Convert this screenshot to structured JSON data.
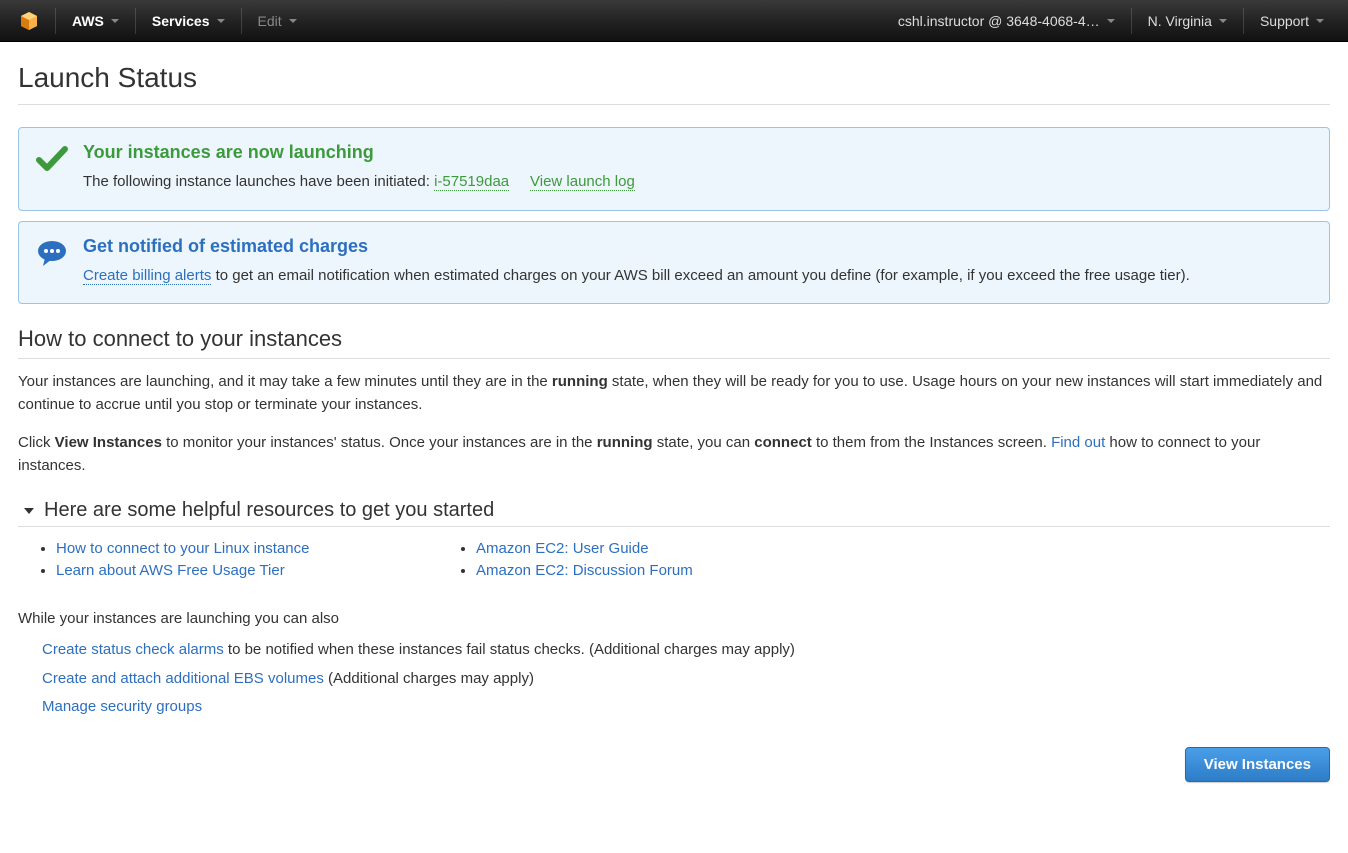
{
  "nav": {
    "aws": "AWS",
    "services": "Services",
    "edit": "Edit",
    "account": "cshl.instructor @ 3648-4068-4…",
    "region": "N. Virginia",
    "support": "Support"
  },
  "page": {
    "title": "Launch Status"
  },
  "alert_success": {
    "title": "Your instances are now launching",
    "text_before": "The following instance launches have been initiated: ",
    "instance_id": "i-57519daa",
    "view_log": "View launch log"
  },
  "alert_info": {
    "title": "Get notified of estimated charges",
    "link": "Create billing alerts",
    "text_after": " to get an email notification when estimated charges on your AWS bill exceed an amount you define (for example, if you exceed the free usage tier)."
  },
  "connect": {
    "heading": "How to connect to your instances",
    "p1_a": "Your instances are launching, and it may take a few minutes until they are in the ",
    "p1_b": "running",
    "p1_c": " state, when they will be ready for you to use. Usage hours on your new instances will start immediately and continue to accrue until you stop or terminate your instances.",
    "p2_a": "Click ",
    "p2_b": "View Instances",
    "p2_c": " to monitor your instances' status. Once your instances are in the ",
    "p2_d": "running",
    "p2_e": " state, you can ",
    "p2_f": "connect",
    "p2_g": " to them from the Instances screen. ",
    "p2_link": "Find out",
    "p2_h": " how to connect to your instances."
  },
  "resources": {
    "heading": "Here are some helpful resources to get you started",
    "col1": [
      "How to connect to your Linux instance",
      "Learn about AWS Free Usage Tier"
    ],
    "col2": [
      "Amazon EC2: User Guide",
      "Amazon EC2: Discussion Forum"
    ]
  },
  "also": {
    "heading": "While your instances are launching you can also",
    "items": [
      {
        "link": "Create status check alarms",
        "text": " to be notified when these instances fail status checks. (Additional charges may apply)"
      },
      {
        "link": "Create and attach additional EBS volumes",
        "text": " (Additional charges may apply)"
      },
      {
        "link": "Manage security groups",
        "text": ""
      }
    ]
  },
  "footer": {
    "view_instances": "View Instances"
  }
}
